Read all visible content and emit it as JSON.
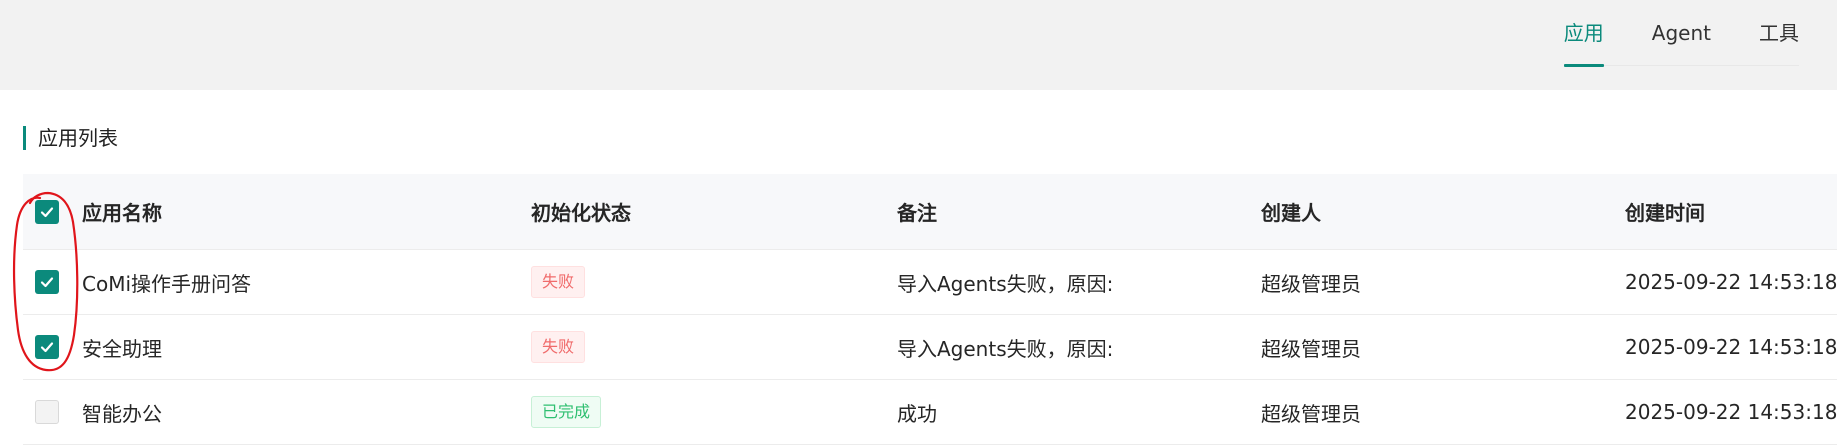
{
  "tabs": [
    {
      "label": "应用",
      "active": true
    },
    {
      "label": "Agent",
      "active": false
    },
    {
      "label": "工具",
      "active": false
    }
  ],
  "section_title": "应用列表",
  "table": {
    "columns": {
      "name": "应用名称",
      "status": "初始化状态",
      "note": "备注",
      "creator": "创建人",
      "time": "创建时间"
    },
    "header_checked": true,
    "rows": [
      {
        "checked": true,
        "name": "CoMi操作手册问答",
        "status": "失败",
        "status_type": "fail",
        "note": "导入Agents失败，原因:",
        "creator": "超级管理员",
        "time": "2025-09-22 14:53:18"
      },
      {
        "checked": true,
        "name": "安全助理",
        "status": "失败",
        "status_type": "fail",
        "note": "导入Agents失败，原因:",
        "creator": "超级管理员",
        "time": "2025-09-22 14:53:18"
      },
      {
        "checked": false,
        "name": "智能办公",
        "status": "已完成",
        "status_type": "done",
        "note": "成功",
        "creator": "超级管理员",
        "time": "2025-09-22 14:53:18"
      }
    ]
  },
  "colors": {
    "accent": "#0b8a7c",
    "fail_text": "#f06b6b",
    "done_text": "#2fbf71",
    "annotation": "#e0151b"
  }
}
